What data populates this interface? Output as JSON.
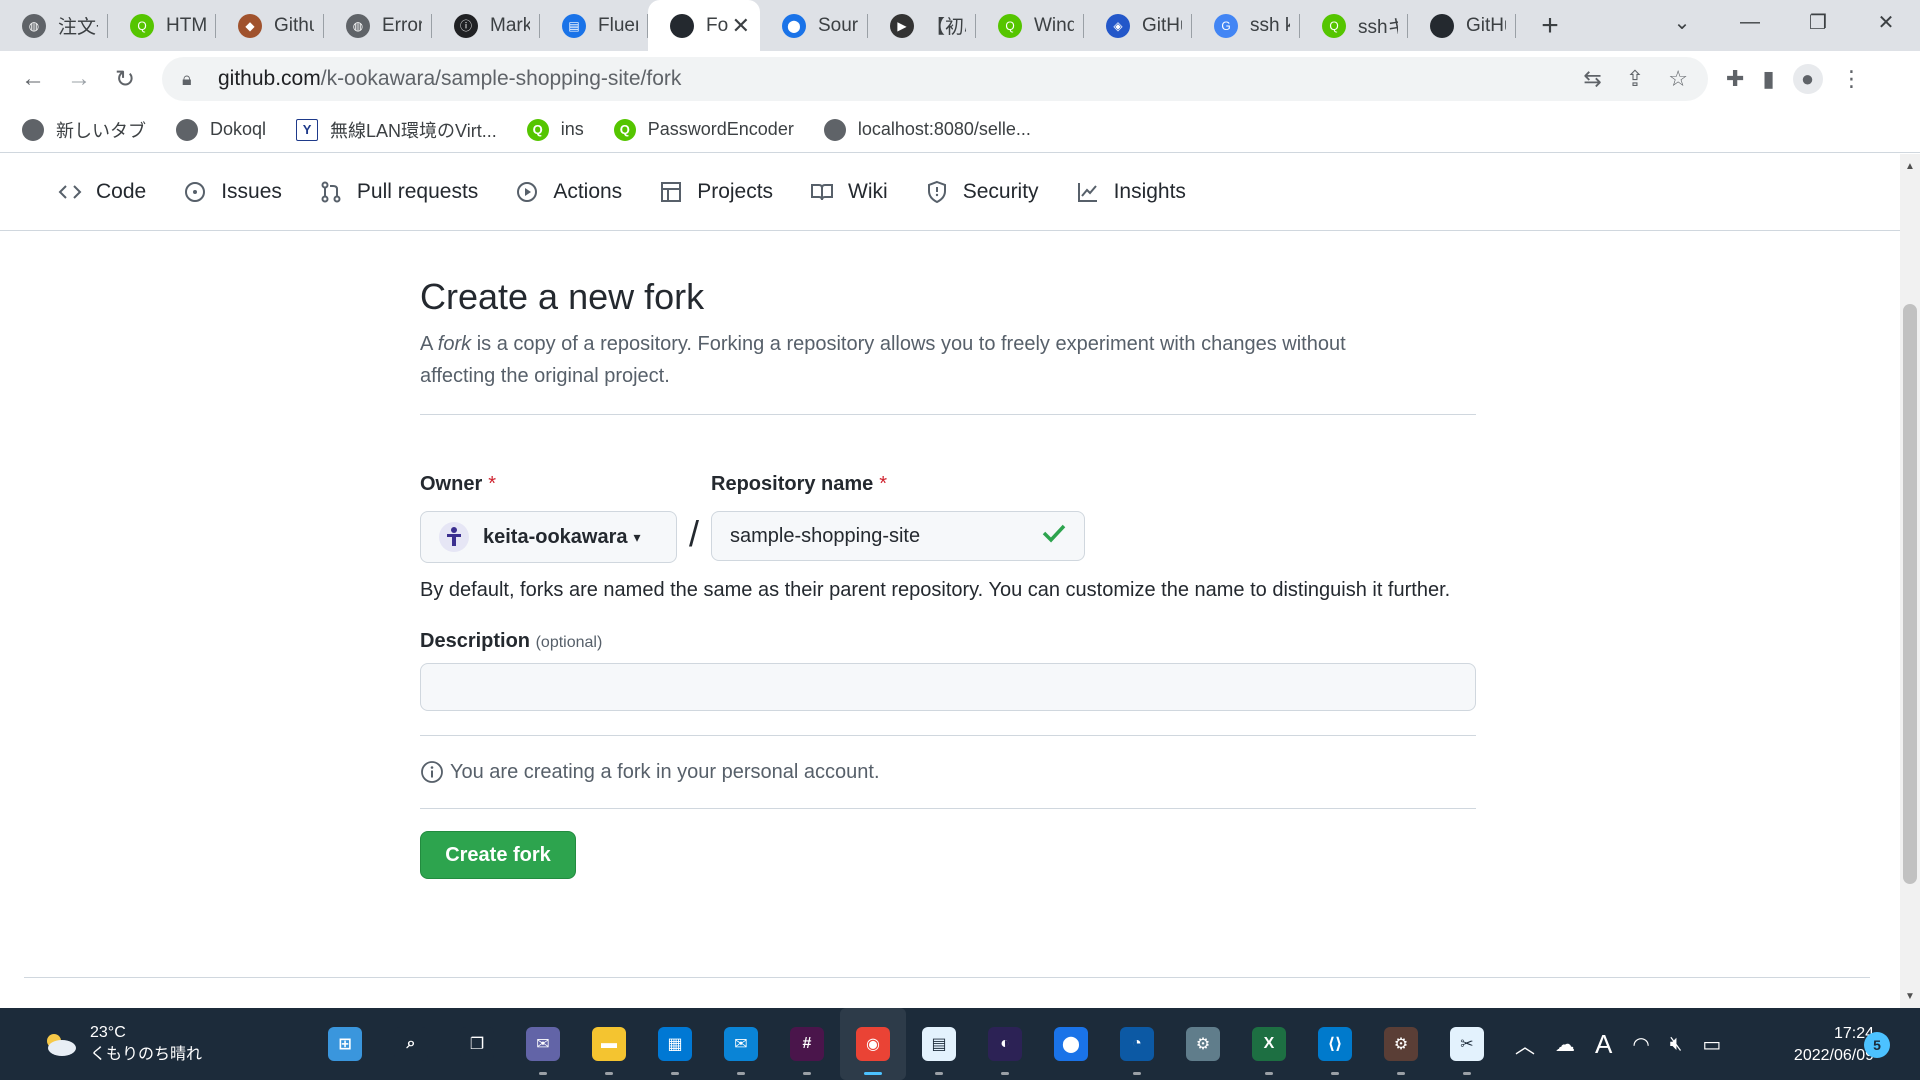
{
  "browser": {
    "tabs": [
      {
        "title": "注文一",
        "icon": "globe-icon",
        "color": "#5f6368"
      },
      {
        "title": "HTML",
        "icon": "qiita-icon",
        "color": "#55c500"
      },
      {
        "title": "Githu",
        "icon": "avatar-icon",
        "color": "#a0522d"
      },
      {
        "title": "Error",
        "icon": "globe-icon",
        "color": "#5f6368"
      },
      {
        "title": "Markd",
        "icon": "info-icon",
        "color": "#202124"
      },
      {
        "title": "Fluent",
        "icon": "doc-icon",
        "color": "#1a73e8"
      },
      {
        "title": "Fo",
        "icon": "github-icon",
        "color": "#24292f",
        "active": true
      },
      {
        "title": "Sourc",
        "icon": "pin-icon",
        "color": "#1a73e8"
      },
      {
        "title": "【初心",
        "icon": "video-icon",
        "color": "#333333"
      },
      {
        "title": "Windo",
        "icon": "qiita-icon",
        "color": "#55c500"
      },
      {
        "title": "GitHu",
        "icon": "shield-icon",
        "color": "#2357c9"
      },
      {
        "title": "ssh ke",
        "icon": "google-icon",
        "color": "#4285f4"
      },
      {
        "title": "sshキ",
        "icon": "qiita-icon",
        "color": "#55c500"
      },
      {
        "title": "GitHu",
        "icon": "github-icon",
        "color": "#24292f"
      }
    ],
    "address": {
      "host": "github.com",
      "path": "/k-ookawara/sample-shopping-site/fork"
    },
    "bookmarks": [
      {
        "label": "新しいタブ",
        "icon": "globe-icon",
        "color": "#5f6368"
      },
      {
        "label": "Dokoql",
        "icon": "globe-icon",
        "color": "#5f6368"
      },
      {
        "label": "無線LAN環境のVirt...",
        "icon": "yahoo-icon",
        "color": "#1e3a8a"
      },
      {
        "label": "ins",
        "icon": "qiita-icon",
        "color": "#55c500"
      },
      {
        "label": "PasswordEncoder",
        "icon": "qiita-icon",
        "color": "#55c500"
      },
      {
        "label": "localhost:8080/selle...",
        "icon": "globe-icon",
        "color": "#5f6368"
      }
    ]
  },
  "repo_nav": {
    "items": [
      {
        "label": "Code",
        "icon": "code-icon"
      },
      {
        "label": "Issues",
        "icon": "issue-icon"
      },
      {
        "label": "Pull requests",
        "icon": "pull-request-icon"
      },
      {
        "label": "Actions",
        "icon": "play-icon"
      },
      {
        "label": "Projects",
        "icon": "table-icon"
      },
      {
        "label": "Wiki",
        "icon": "book-icon"
      },
      {
        "label": "Security",
        "icon": "shield-icon"
      },
      {
        "label": "Insights",
        "icon": "graph-icon"
      }
    ]
  },
  "form": {
    "title": "Create a new fork",
    "lead_pre": "A ",
    "lead_em": "fork",
    "lead_post": " is a copy of a repository. Forking a repository allows you to freely experiment with changes without affecting the original project.",
    "owner_label": "Owner",
    "required_mark": "*",
    "owner_value": "keita-ookawara",
    "separator": "/",
    "repo_label": "Repository name",
    "repo_value": "sample-shopping-site",
    "name_help": "By default, forks are named the same as their parent repository. You can customize the name to distinguish it further.",
    "description_label": "Description",
    "description_optional": "(optional)",
    "description_value": "",
    "account_note": "You are creating a fork in your personal account.",
    "submit_label": "Create fork",
    "accent": "#2da44e"
  },
  "taskbar": {
    "weather_temp": "23°C",
    "weather_desc": "くもりのち晴れ",
    "apps": [
      {
        "name": "start",
        "icon": "windows-icon",
        "color": "#3a96dd"
      },
      {
        "name": "search",
        "icon": "search-icon",
        "color": "#1c2b3a"
      },
      {
        "name": "task-view",
        "icon": "taskview-icon",
        "color": "#1c2b3a"
      },
      {
        "name": "teams-chat",
        "icon": "chat-icon",
        "color": "#6264a7"
      },
      {
        "name": "file-explorer",
        "icon": "folder-icon",
        "color": "#f4c430"
      },
      {
        "name": "microsoft-store",
        "icon": "store-icon",
        "color": "#0078d4"
      },
      {
        "name": "mail",
        "icon": "mail-icon",
        "color": "#0a84d6"
      },
      {
        "name": "slack",
        "icon": "slack-icon",
        "color": "#4a154b"
      },
      {
        "name": "chrome",
        "icon": "chrome-icon",
        "color": "#ea4335",
        "active": true
      },
      {
        "name": "notepad",
        "icon": "notepad-icon",
        "color": "#e3f2fd"
      },
      {
        "name": "eclipse",
        "icon": "eclipse-icon",
        "color": "#2c2255"
      },
      {
        "name": "maps",
        "icon": "pin-icon",
        "color": "#1a73e8"
      },
      {
        "name": "edge",
        "icon": "edge-icon",
        "color": "#0c59a4"
      },
      {
        "name": "settings",
        "icon": "gear-icon",
        "color": "#607d8b"
      },
      {
        "name": "excel",
        "icon": "excel-icon",
        "color": "#1d6f42"
      },
      {
        "name": "vscode",
        "icon": "vscode-icon",
        "color": "#007acc"
      },
      {
        "name": "db-tool",
        "icon": "gear-icon",
        "color": "#5a3e36"
      },
      {
        "name": "snipping",
        "icon": "snip-icon",
        "color": "#e3f2fd"
      }
    ],
    "ime_indicator": "A",
    "time": "17:24",
    "date": "2022/06/09",
    "notification_count": "5"
  }
}
